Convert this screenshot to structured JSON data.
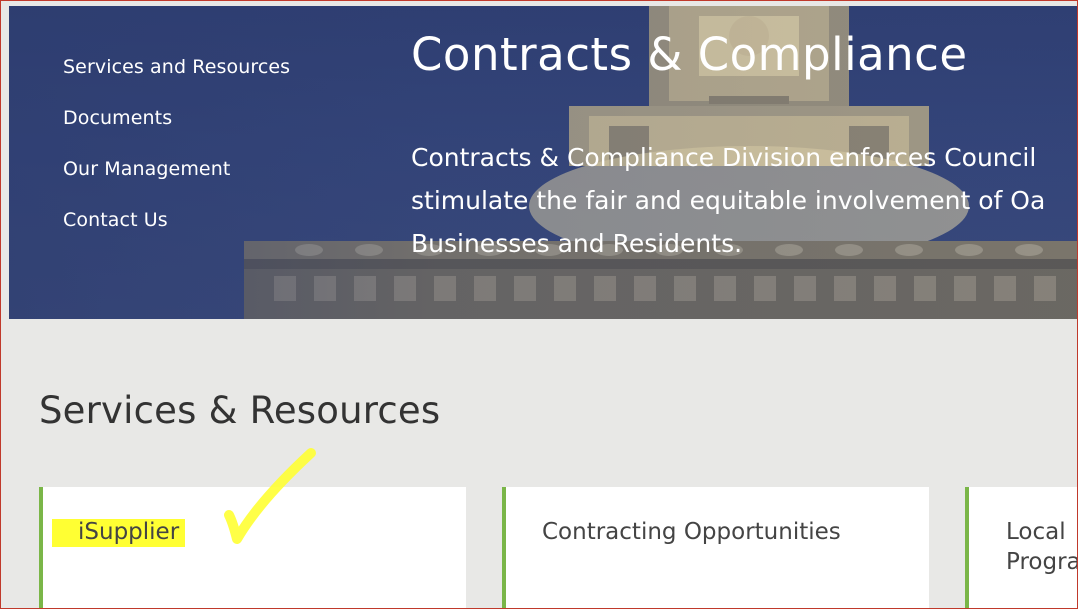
{
  "hero": {
    "nav": [
      {
        "label": "Services and Resources"
      },
      {
        "label": "Documents"
      },
      {
        "label": "Our Management"
      },
      {
        "label": "Contact Us"
      }
    ],
    "title": "Contracts & Compliance",
    "description_lines": [
      "Contracts & Compliance Division enforces Council",
      "stimulate the fair and equitable involvement of Oa",
      "Businesses and Residents."
    ]
  },
  "services": {
    "heading": "Services & Resources",
    "cards": [
      {
        "title": "iSupplier",
        "highlighted": true
      },
      {
        "title": "Contracting Opportunities"
      },
      {
        "title_lines": [
          "Local",
          "Progra"
        ]
      }
    ]
  },
  "annotation": {
    "mark": "checkmark",
    "color": "#ffff33"
  },
  "colors": {
    "hero_bg": "#34457a",
    "card_accent": "#7ab648",
    "section_bg": "#e8e8e6",
    "highlight": "#ffff33"
  }
}
